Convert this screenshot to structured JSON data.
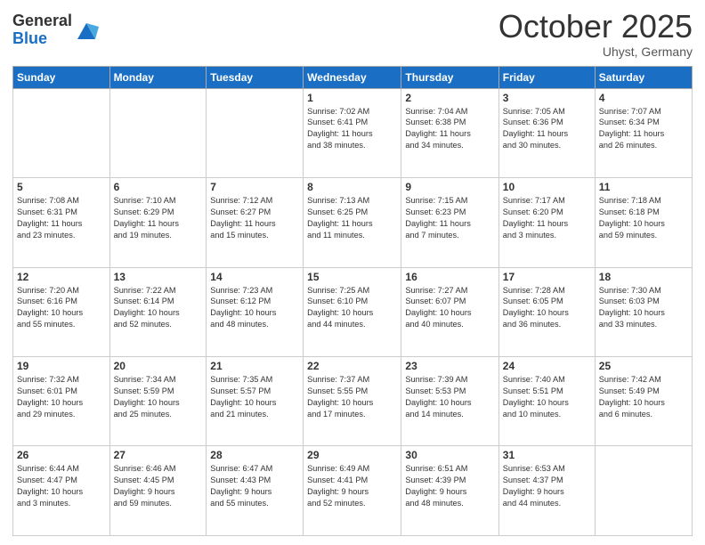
{
  "header": {
    "logo_general": "General",
    "logo_blue": "Blue",
    "month_title": "October 2025",
    "location": "Uhyst, Germany"
  },
  "weekdays": [
    "Sunday",
    "Monday",
    "Tuesday",
    "Wednesday",
    "Thursday",
    "Friday",
    "Saturday"
  ],
  "weeks": [
    [
      {
        "day": "",
        "info": ""
      },
      {
        "day": "",
        "info": ""
      },
      {
        "day": "",
        "info": ""
      },
      {
        "day": "1",
        "info": "Sunrise: 7:02 AM\nSunset: 6:41 PM\nDaylight: 11 hours\nand 38 minutes."
      },
      {
        "day": "2",
        "info": "Sunrise: 7:04 AM\nSunset: 6:38 PM\nDaylight: 11 hours\nand 34 minutes."
      },
      {
        "day": "3",
        "info": "Sunrise: 7:05 AM\nSunset: 6:36 PM\nDaylight: 11 hours\nand 30 minutes."
      },
      {
        "day": "4",
        "info": "Sunrise: 7:07 AM\nSunset: 6:34 PM\nDaylight: 11 hours\nand 26 minutes."
      }
    ],
    [
      {
        "day": "5",
        "info": "Sunrise: 7:08 AM\nSunset: 6:31 PM\nDaylight: 11 hours\nand 23 minutes."
      },
      {
        "day": "6",
        "info": "Sunrise: 7:10 AM\nSunset: 6:29 PM\nDaylight: 11 hours\nand 19 minutes."
      },
      {
        "day": "7",
        "info": "Sunrise: 7:12 AM\nSunset: 6:27 PM\nDaylight: 11 hours\nand 15 minutes."
      },
      {
        "day": "8",
        "info": "Sunrise: 7:13 AM\nSunset: 6:25 PM\nDaylight: 11 hours\nand 11 minutes."
      },
      {
        "day": "9",
        "info": "Sunrise: 7:15 AM\nSunset: 6:23 PM\nDaylight: 11 hours\nand 7 minutes."
      },
      {
        "day": "10",
        "info": "Sunrise: 7:17 AM\nSunset: 6:20 PM\nDaylight: 11 hours\nand 3 minutes."
      },
      {
        "day": "11",
        "info": "Sunrise: 7:18 AM\nSunset: 6:18 PM\nDaylight: 10 hours\nand 59 minutes."
      }
    ],
    [
      {
        "day": "12",
        "info": "Sunrise: 7:20 AM\nSunset: 6:16 PM\nDaylight: 10 hours\nand 55 minutes."
      },
      {
        "day": "13",
        "info": "Sunrise: 7:22 AM\nSunset: 6:14 PM\nDaylight: 10 hours\nand 52 minutes."
      },
      {
        "day": "14",
        "info": "Sunrise: 7:23 AM\nSunset: 6:12 PM\nDaylight: 10 hours\nand 48 minutes."
      },
      {
        "day": "15",
        "info": "Sunrise: 7:25 AM\nSunset: 6:10 PM\nDaylight: 10 hours\nand 44 minutes."
      },
      {
        "day": "16",
        "info": "Sunrise: 7:27 AM\nSunset: 6:07 PM\nDaylight: 10 hours\nand 40 minutes."
      },
      {
        "day": "17",
        "info": "Sunrise: 7:28 AM\nSunset: 6:05 PM\nDaylight: 10 hours\nand 36 minutes."
      },
      {
        "day": "18",
        "info": "Sunrise: 7:30 AM\nSunset: 6:03 PM\nDaylight: 10 hours\nand 33 minutes."
      }
    ],
    [
      {
        "day": "19",
        "info": "Sunrise: 7:32 AM\nSunset: 6:01 PM\nDaylight: 10 hours\nand 29 minutes."
      },
      {
        "day": "20",
        "info": "Sunrise: 7:34 AM\nSunset: 5:59 PM\nDaylight: 10 hours\nand 25 minutes."
      },
      {
        "day": "21",
        "info": "Sunrise: 7:35 AM\nSunset: 5:57 PM\nDaylight: 10 hours\nand 21 minutes."
      },
      {
        "day": "22",
        "info": "Sunrise: 7:37 AM\nSunset: 5:55 PM\nDaylight: 10 hours\nand 17 minutes."
      },
      {
        "day": "23",
        "info": "Sunrise: 7:39 AM\nSunset: 5:53 PM\nDaylight: 10 hours\nand 14 minutes."
      },
      {
        "day": "24",
        "info": "Sunrise: 7:40 AM\nSunset: 5:51 PM\nDaylight: 10 hours\nand 10 minutes."
      },
      {
        "day": "25",
        "info": "Sunrise: 7:42 AM\nSunset: 5:49 PM\nDaylight: 10 hours\nand 6 minutes."
      }
    ],
    [
      {
        "day": "26",
        "info": "Sunrise: 6:44 AM\nSunset: 4:47 PM\nDaylight: 10 hours\nand 3 minutes."
      },
      {
        "day": "27",
        "info": "Sunrise: 6:46 AM\nSunset: 4:45 PM\nDaylight: 9 hours\nand 59 minutes."
      },
      {
        "day": "28",
        "info": "Sunrise: 6:47 AM\nSunset: 4:43 PM\nDaylight: 9 hours\nand 55 minutes."
      },
      {
        "day": "29",
        "info": "Sunrise: 6:49 AM\nSunset: 4:41 PM\nDaylight: 9 hours\nand 52 minutes."
      },
      {
        "day": "30",
        "info": "Sunrise: 6:51 AM\nSunset: 4:39 PM\nDaylight: 9 hours\nand 48 minutes."
      },
      {
        "day": "31",
        "info": "Sunrise: 6:53 AM\nSunset: 4:37 PM\nDaylight: 9 hours\nand 44 minutes."
      },
      {
        "day": "",
        "info": ""
      }
    ]
  ]
}
